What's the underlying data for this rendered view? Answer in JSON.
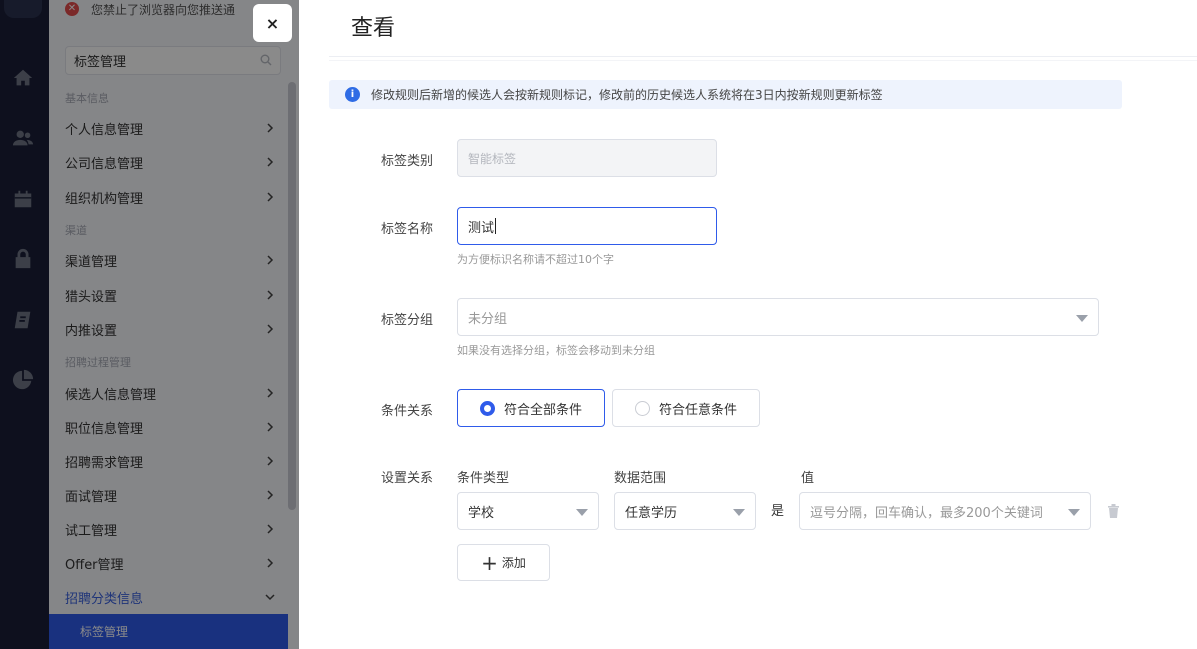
{
  "notice": {
    "text": "您禁止了浏览器向您推送通"
  },
  "sidebar": {
    "search_value": "标签管理",
    "groups": [
      {
        "title": "基本信息",
        "items": [
          "个人信息管理",
          "公司信息管理",
          "组织机构管理"
        ]
      },
      {
        "title": "渠道",
        "items": [
          "渠道管理",
          "猎头设置",
          "内推设置"
        ]
      },
      {
        "title": "招聘过程管理",
        "items": [
          "候选人信息管理",
          "职位信息管理",
          "招聘需求管理",
          "面试管理",
          "试工管理",
          "Offer管理",
          "招聘分类信息"
        ]
      }
    ],
    "active_sub": "标签管理"
  },
  "close_label": "×",
  "drawer": {
    "title": "查看",
    "info": "修改规则后新增的候选人会按新规则标记，修改前的历史候选人系统将在3日内按新规则更新标签",
    "tag_type": {
      "label": "标签类别",
      "value": "智能标签"
    },
    "tag_name": {
      "label": "标签名称",
      "value": "测试",
      "hint": "为方便标识名称请不超过10个字"
    },
    "tag_group": {
      "label": "标签分组",
      "placeholder": "未分组",
      "hint": "如果没有选择分组，标签会移动到未分组"
    },
    "relation": {
      "label": "条件关系",
      "options": [
        "符合全部条件",
        "符合任意条件"
      ],
      "selected_index": 0
    },
    "conditions": {
      "label": "设置关系",
      "col_type": "条件类型",
      "col_range": "数据范围",
      "col_value": "值",
      "type_value": "学校",
      "range_value": "任意学历",
      "op": "是",
      "value_placeholder": "逗号分隔，回车确认，最多200个关键词"
    },
    "add_label": "添加"
  },
  "colors": {
    "accent": "#2f5bea",
    "rail": "#1a1f38",
    "info_bg": "#eef3fd"
  }
}
